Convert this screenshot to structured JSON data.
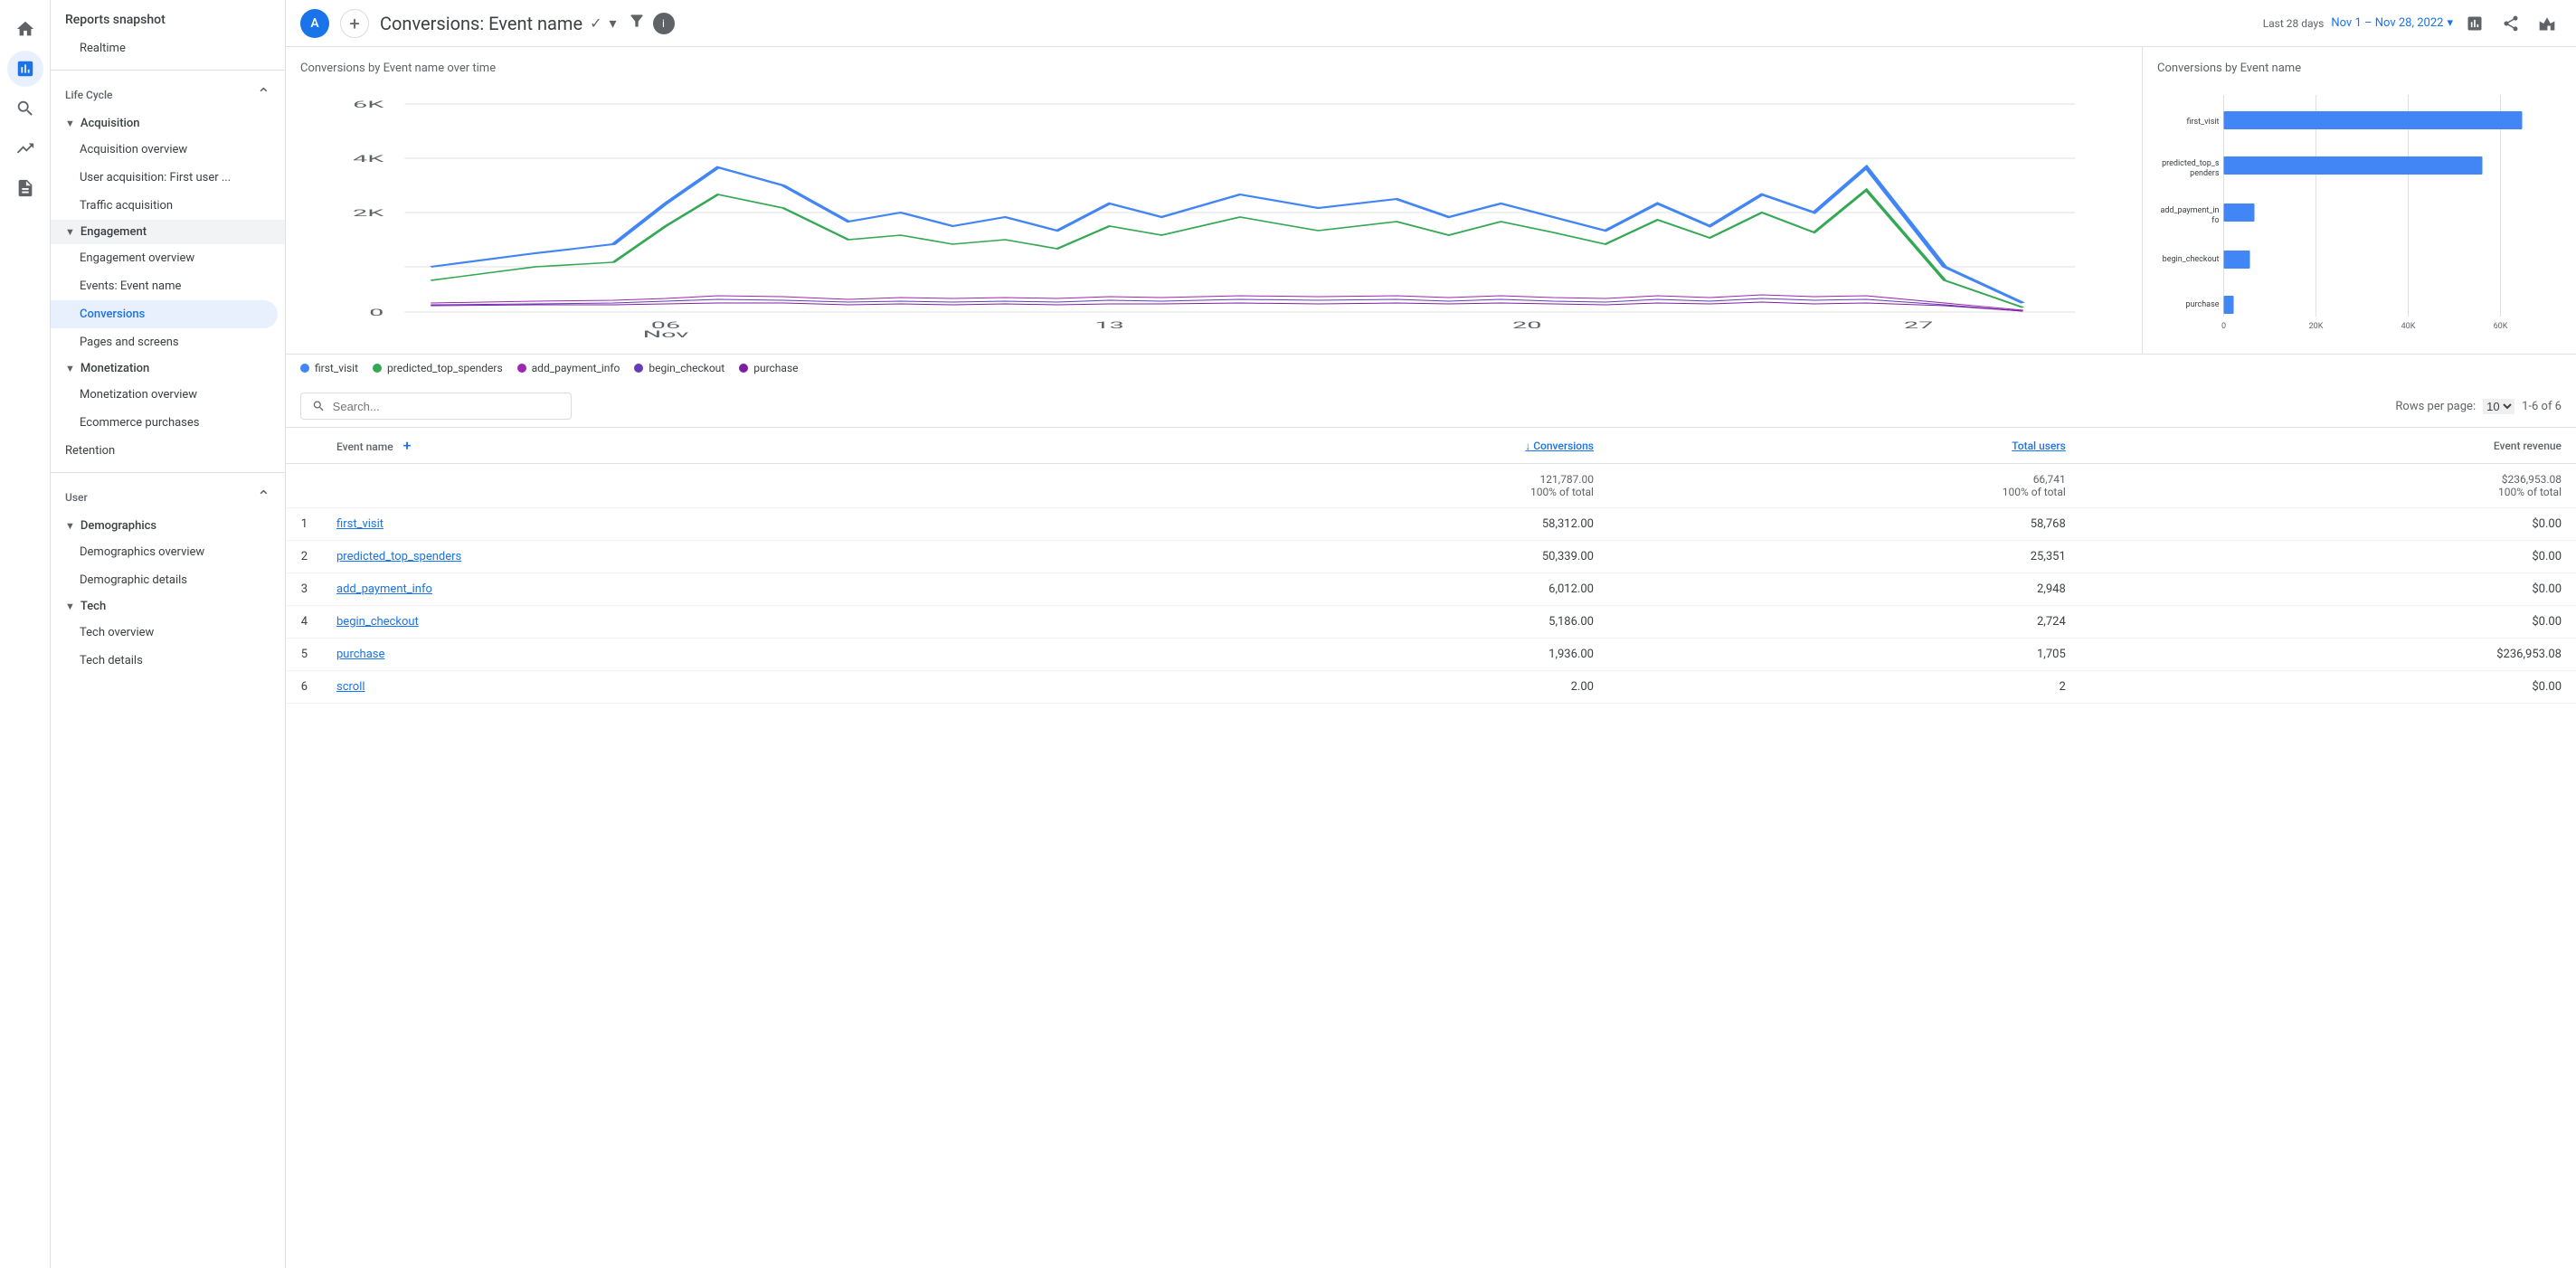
{
  "nav": {
    "icons": [
      "home",
      "analytics",
      "chat",
      "trending",
      "list"
    ]
  },
  "sidebar": {
    "title": "Reports snapshot",
    "realtime": "Realtime",
    "sections": [
      {
        "label": "Life Cycle",
        "expanded": true,
        "items": [
          {
            "label": "Acquisition",
            "type": "header",
            "indent": 1
          },
          {
            "label": "Acquisition overview",
            "type": "item",
            "indent": 2
          },
          {
            "label": "User acquisition: First user ...",
            "type": "item",
            "indent": 2
          },
          {
            "label": "Traffic acquisition",
            "type": "item",
            "indent": 2
          },
          {
            "label": "Engagement",
            "type": "header",
            "indent": 1,
            "active": true
          },
          {
            "label": "Engagement overview",
            "type": "item",
            "indent": 2
          },
          {
            "label": "Events: Event name",
            "type": "item",
            "indent": 2
          },
          {
            "label": "Conversions",
            "type": "item",
            "indent": 2,
            "active": true
          },
          {
            "label": "Pages and screens",
            "type": "item",
            "indent": 2
          },
          {
            "label": "Monetization",
            "type": "header",
            "indent": 1
          },
          {
            "label": "Monetization overview",
            "type": "item",
            "indent": 2
          },
          {
            "label": "Ecommerce purchases",
            "type": "item",
            "indent": 2
          },
          {
            "label": "Retention",
            "type": "item",
            "indent": 1
          }
        ]
      },
      {
        "label": "User",
        "expanded": true,
        "items": [
          {
            "label": "Demographics",
            "type": "header",
            "indent": 1
          },
          {
            "label": "Demographics overview",
            "type": "item",
            "indent": 2
          },
          {
            "label": "Demographic details",
            "type": "item",
            "indent": 2
          },
          {
            "label": "Tech",
            "type": "header",
            "indent": 1
          },
          {
            "label": "Tech overview",
            "type": "item",
            "indent": 2
          },
          {
            "label": "Tech details",
            "type": "item",
            "indent": 2
          }
        ]
      }
    ]
  },
  "header": {
    "avatar_letter": "A",
    "page_title": "Conversions: Event name",
    "last_days": "Last 28 days",
    "date_range": "Nov 1 – Nov 28, 2022"
  },
  "chart": {
    "line_title": "Conversions by Event name over time",
    "bar_title": "Conversions by Event name",
    "x_labels": [
      "06 Nov",
      "13",
      "20",
      "27"
    ],
    "y_labels": [
      "6K",
      "4K",
      "2K",
      "0"
    ],
    "bar_x_labels": [
      "0",
      "20K",
      "40K",
      "60K"
    ],
    "legend": [
      {
        "label": "first_visit",
        "color": "#4285f4"
      },
      {
        "label": "predicted_top_spenders",
        "color": "#34a853"
      },
      {
        "label": "add_payment_info",
        "color": "#9c27b0"
      },
      {
        "label": "begin_checkout",
        "color": "#673ab7"
      },
      {
        "label": "purchase",
        "color": "#7b1fa2"
      }
    ],
    "bar_data": [
      {
        "label": "first_visit",
        "value": 58312,
        "max": 60000
      },
      {
        "label": "predicted_top_s\npenders",
        "value": 50339,
        "max": 60000
      },
      {
        "label": "add_payment_in\nfo",
        "value": 6012,
        "max": 60000
      },
      {
        "label": "begin_checkout",
        "value": 5186,
        "max": 60000
      },
      {
        "label": "purchase",
        "value": 1936,
        "max": 60000
      }
    ]
  },
  "table": {
    "search_placeholder": "Search...",
    "rows_per_page_label": "Rows per page:",
    "rows_per_page_value": "10",
    "page_info": "1-6 of 6",
    "columns": [
      {
        "label": "Event name",
        "align": "left"
      },
      {
        "label": "↓ Conversions",
        "align": "right",
        "sortable": true
      },
      {
        "label": "Total users",
        "align": "right",
        "sortable": true
      },
      {
        "label": "Event revenue",
        "align": "right"
      }
    ],
    "totals": {
      "conversions": "121,787.00",
      "conversions_pct": "100% of total",
      "users": "66,741",
      "users_pct": "100% of total",
      "revenue": "$236,953.08",
      "revenue_pct": "100% of total"
    },
    "rows": [
      {
        "num": 1,
        "event": "first_visit",
        "conversions": "58,312.00",
        "users": "58,768",
        "revenue": "$0.00"
      },
      {
        "num": 2,
        "event": "predicted_top_spenders",
        "conversions": "50,339.00",
        "users": "25,351",
        "revenue": "$0.00"
      },
      {
        "num": 3,
        "event": "add_payment_info",
        "conversions": "6,012.00",
        "users": "2,948",
        "revenue": "$0.00"
      },
      {
        "num": 4,
        "event": "begin_checkout",
        "conversions": "5,186.00",
        "users": "2,724",
        "revenue": "$0.00"
      },
      {
        "num": 5,
        "event": "purchase",
        "conversions": "1,936.00",
        "users": "1,705",
        "revenue": "$236,953.08"
      },
      {
        "num": 6,
        "event": "scroll",
        "conversions": "2.00",
        "users": "2",
        "revenue": "$0.00"
      }
    ]
  }
}
